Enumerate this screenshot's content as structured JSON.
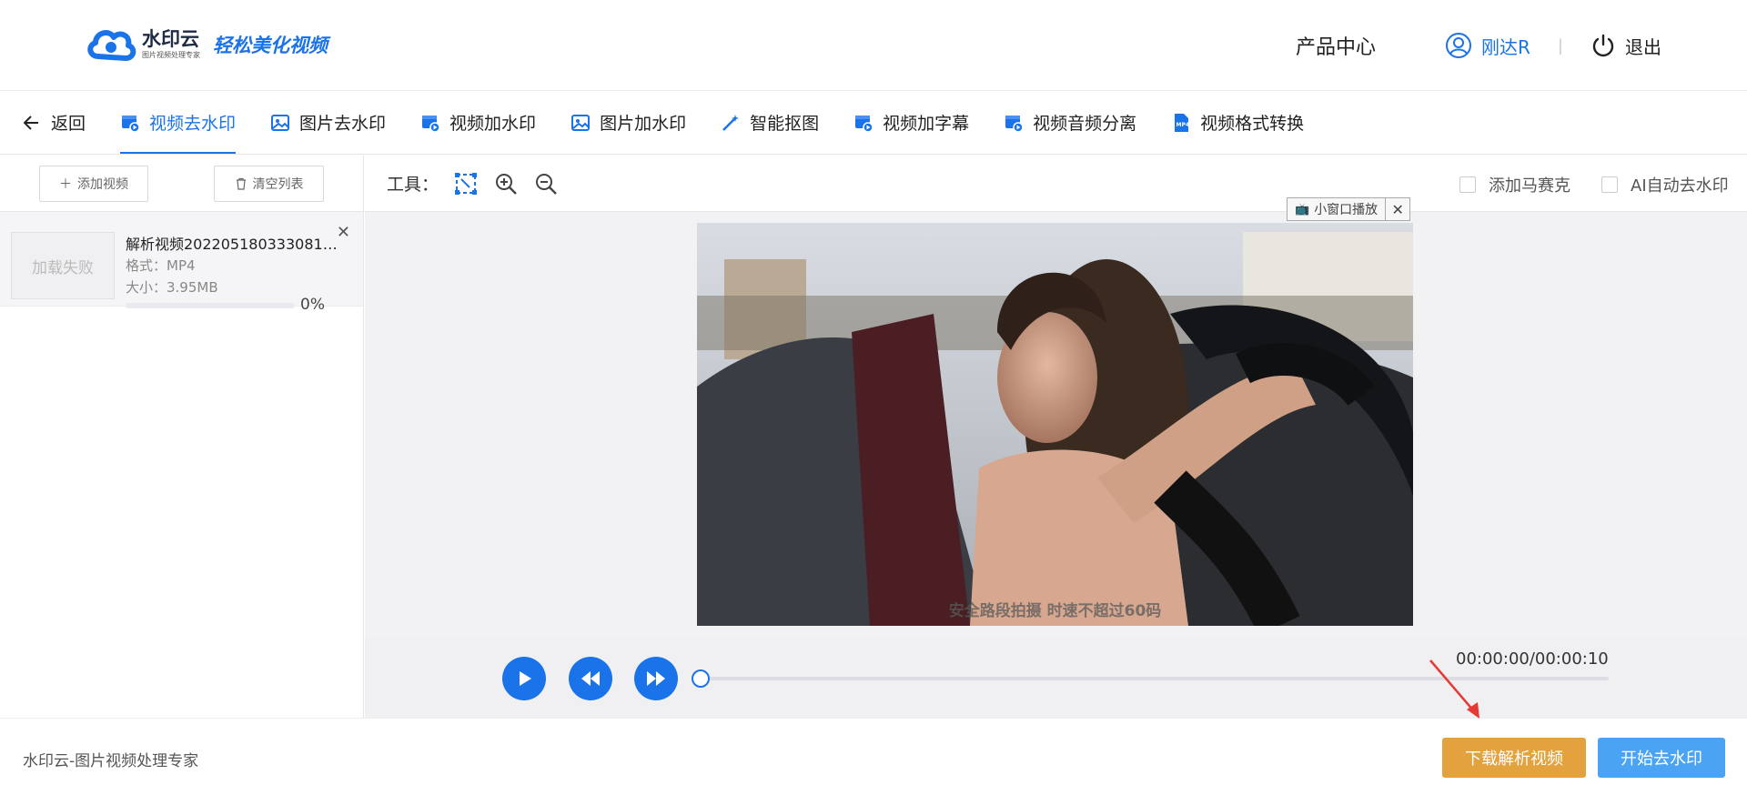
{
  "header": {
    "logo_name": "水印云",
    "logo_sub": "图片视频处理专家",
    "slogan": "轻松美化视频",
    "product_center": "产品中心",
    "username": "刚达R",
    "separator": "|",
    "logout": "退出"
  },
  "nav": {
    "back": "返回",
    "tabs": [
      {
        "label": "视频去水印",
        "icon": "video-icon",
        "active": true
      },
      {
        "label": "图片去水印",
        "icon": "image-icon",
        "active": false
      },
      {
        "label": "视频加水印",
        "icon": "video-icon",
        "active": false
      },
      {
        "label": "图片加水印",
        "icon": "image-icon",
        "active": false
      },
      {
        "label": "智能抠图",
        "icon": "magic-wand-icon",
        "active": false
      },
      {
        "label": "视频加字幕",
        "icon": "video-icon",
        "active": false
      },
      {
        "label": "视频音频分离",
        "icon": "video-icon",
        "active": false
      },
      {
        "label": "视频格式转换",
        "icon": "mp4-icon",
        "active": false
      }
    ]
  },
  "sidebar": {
    "add_video": "添加视频",
    "clear_list": "清空列表",
    "files": [
      {
        "thumb_text": "加载失败",
        "name": "解析视频20220518033308131...",
        "format": "格式：MP4",
        "size": "大小：3.95MB",
        "progress_text": "0%",
        "progress": 0
      }
    ]
  },
  "toolbar": {
    "label": "工具：",
    "tools": [
      "select-region-icon",
      "zoom-in-icon",
      "zoom-out-icon"
    ],
    "add_mosaic": "添加马赛克",
    "ai_remove": "AI自动去水印"
  },
  "preview": {
    "mini_window": "小窗口播放",
    "subtitle": "安全路段拍摄 时速不超过60码"
  },
  "player": {
    "time": "00:00:00/00:00:10",
    "progress": 0
  },
  "footer": {
    "brand_text": "水印云-图片视频处理专家",
    "download_btn": "下载解析视频",
    "start_btn": "开始去水印"
  },
  "colors": {
    "accent": "#1a73e8",
    "download": "#e3a23d",
    "start": "#4aa3f3",
    "annotation_arrow": "#e53935"
  }
}
